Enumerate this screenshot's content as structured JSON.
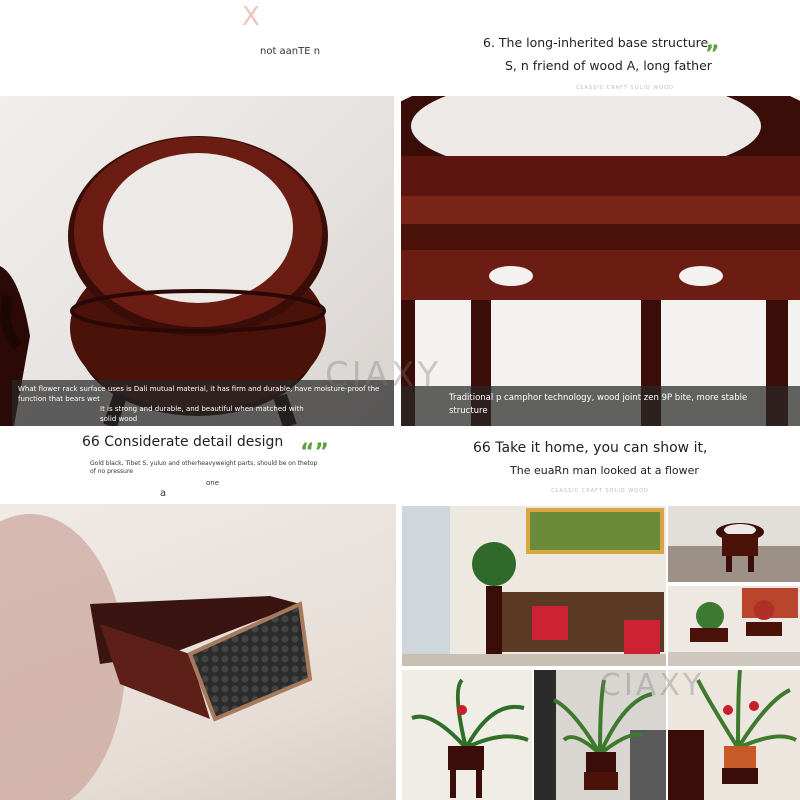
{
  "top_left": {
    "brand_fragment": "XY",
    "text": "not aanTE n"
  },
  "section_top_right": {
    "title": "6. The long-inherited base structure",
    "subtitle": "S, n friend of wood A, long father",
    "tag": "CLASSIC CRAFT SOLID WOOD",
    "quote_mark": "”"
  },
  "photo_left_caption": {
    "line1": "What flower rack surface uses is Dali mutual material, it has firm and durable, have moisture-proof the",
    "line2": "function that bears wet",
    "line3": "It is strong and durable, and beautiful when matched with",
    "line4": "solid wood"
  },
  "photo_right_caption": {
    "line1": "Traditional p camphor technology, wood joint zen 9P bite, more stable",
    "line2": "structure"
  },
  "watermark": "CIAXY",
  "watermark_bottom": "CIAXY",
  "section_mid_left": {
    "title": "66 Considerate detail design",
    "quote_mark": "“”",
    "desc1": "Gold black, Tibet S, yuluo and otherheavyweight parts, should be on thetop",
    "desc2": "of no pressure",
    "word_one": "one",
    "word_a": "a"
  },
  "section_mid_right": {
    "title": "66 Take it home, you can show it,",
    "subtitle": "The euaRn man looked at a flower",
    "tag": "CLASSIC CRAFT SOLID WOOD"
  },
  "colors": {
    "wood_dark": "#3a0f0a",
    "wood_mid": "#6b1d14",
    "marble": "#ece9e6",
    "caption_bg": "#333333"
  }
}
